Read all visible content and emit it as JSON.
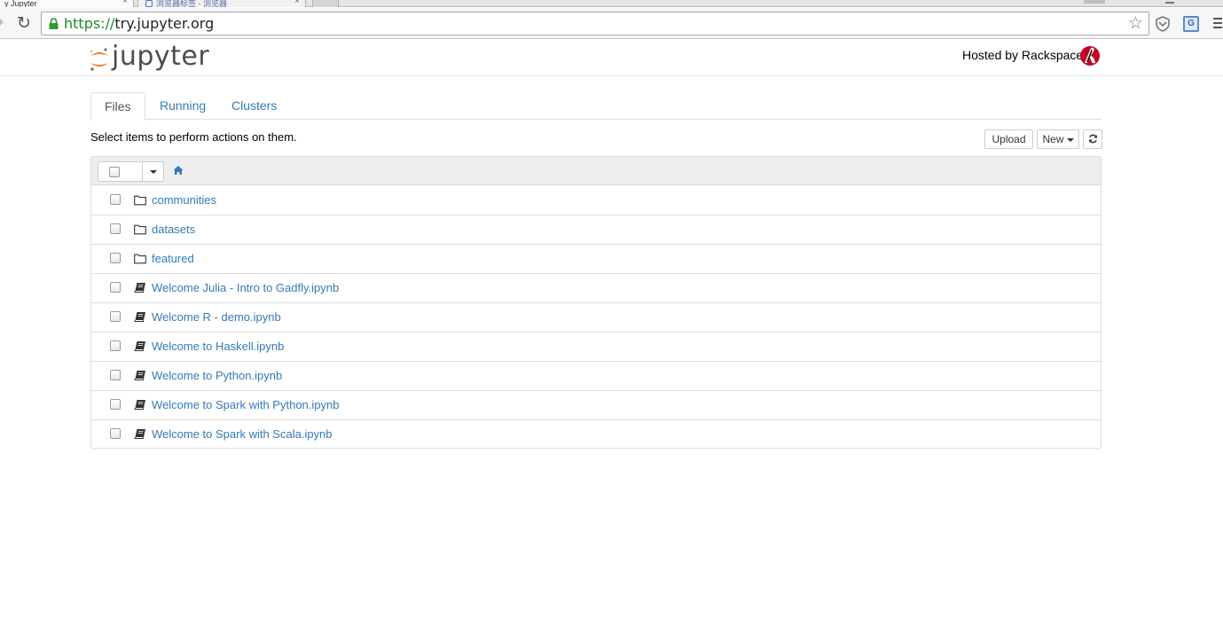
{
  "browser": {
    "tabs": [
      {
        "label": "y Jupyter"
      },
      {
        "label": "浏览器标签 - 浏览器"
      },
      {
        "label": ""
      }
    ],
    "url_scheme": "https://",
    "url_host": "try.jupyter.org"
  },
  "header": {
    "logo_text": "jupyter",
    "hosted_by": "Hosted by Rackspace"
  },
  "tabs": [
    {
      "label": "Files",
      "active": true
    },
    {
      "label": "Running",
      "active": false
    },
    {
      "label": "Clusters",
      "active": false
    }
  ],
  "toolbar": {
    "hint": "Select items to perform actions on them.",
    "upload_label": "Upload",
    "new_label": "New"
  },
  "files": [
    {
      "type": "folder",
      "name": "communities"
    },
    {
      "type": "folder",
      "name": "datasets"
    },
    {
      "type": "folder",
      "name": "featured"
    },
    {
      "type": "notebook",
      "name": "Welcome Julia - Intro to Gadfly.ipynb"
    },
    {
      "type": "notebook",
      "name": "Welcome R - demo.ipynb"
    },
    {
      "type": "notebook",
      "name": "Welcome to Haskell.ipynb"
    },
    {
      "type": "notebook",
      "name": "Welcome to Python.ipynb"
    },
    {
      "type": "notebook",
      "name": "Welcome to Spark with Python.ipynb"
    },
    {
      "type": "notebook",
      "name": "Welcome to Spark with Scala.ipynb"
    }
  ],
  "colors": {
    "link": "#337ab7",
    "jupyter_orange": "#f37626",
    "rackspace_red": "#c40022"
  }
}
